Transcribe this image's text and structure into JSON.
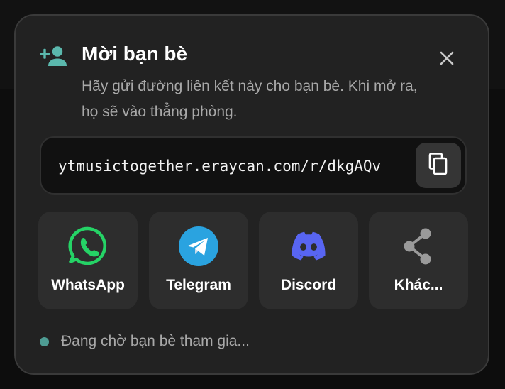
{
  "dialog": {
    "title": "Mời bạn bè",
    "description": "Hãy gửi đường liên kết này cho bạn bè. Khi mở ra, họ sẽ vào thẳng phòng.",
    "header_icon": "add-person-icon",
    "close_icon": "close-icon"
  },
  "invite_link": {
    "url": "ytmusictogether.eraycan.com/r/dkgAQv",
    "copy_icon": "copy-icon"
  },
  "share_options": [
    {
      "label": "WhatsApp",
      "icon": "whatsapp-icon",
      "color": "#25D366"
    },
    {
      "label": "Telegram",
      "icon": "telegram-icon",
      "color": "#2AA3E0"
    },
    {
      "label": "Discord",
      "icon": "discord-icon",
      "color": "#5865F2"
    },
    {
      "label": "Khác...",
      "icon": "share-icon",
      "color": "#9A9A9A"
    }
  ],
  "status": {
    "text": "Đang chờ bạn bè tham gia...",
    "dot_color": "#4E9C93"
  },
  "colors": {
    "accent": "#5BB8AD",
    "dialog_background": "#222222",
    "card_background": "#2D2D2D"
  }
}
